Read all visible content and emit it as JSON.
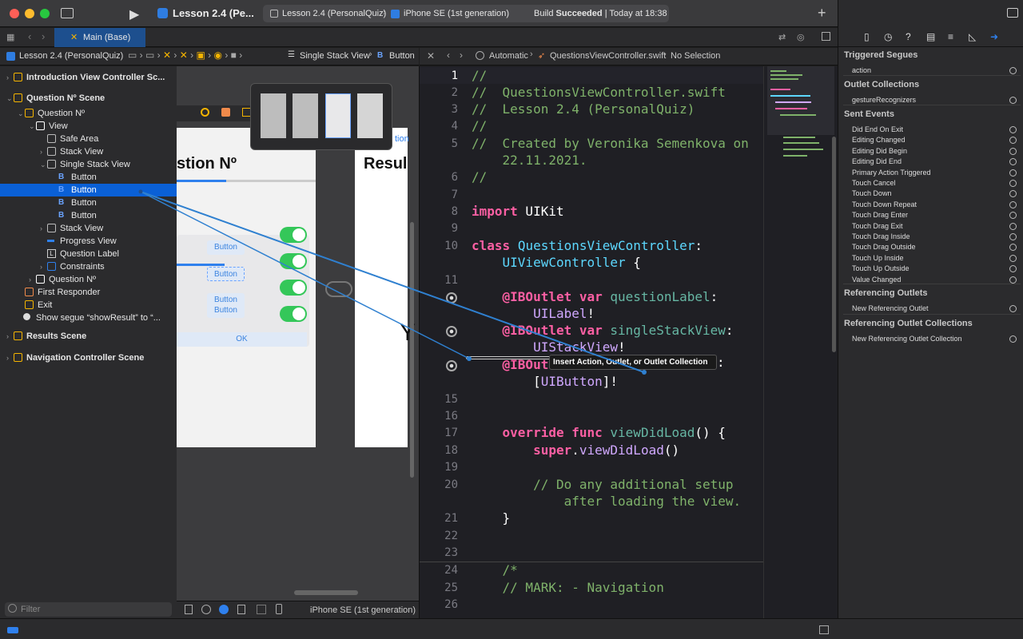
{
  "toolbar": {
    "project_title": "Lesson 2.4 (Pe...",
    "scheme": "Lesson 2.4 (PersonalQuiz)",
    "device": "iPhone SE (1st generation)",
    "build_prefix": "Build ",
    "build_status": "Succeeded",
    "build_time": "| Today at 18:38"
  },
  "tab": {
    "label": "Main (Base)"
  },
  "jumpbar_left": {
    "project": "Lesson 2.4 (PersonalQuiz)",
    "stack": "Single Stack View",
    "button": "Button"
  },
  "jumpbar_right": {
    "mode": "Automatic",
    "file": "QuestionsViewController.swift",
    "selection": "No Selection"
  },
  "navigator": {
    "items": [
      {
        "label": "Introduction View Controller Sc...",
        "bold": true
      },
      {
        "label": "Question Nº Scene",
        "bold": true
      },
      {
        "label": "Question Nº"
      },
      {
        "label": "View"
      },
      {
        "label": "Safe Area"
      },
      {
        "label": "Stack View"
      },
      {
        "label": "Single Stack View"
      },
      {
        "label": "Button"
      },
      {
        "label": "Button"
      },
      {
        "label": "Button"
      },
      {
        "label": "Button"
      },
      {
        "label": "Stack View"
      },
      {
        "label": "Progress View"
      },
      {
        "label": "Question Label"
      },
      {
        "label": "Constraints"
      },
      {
        "label": "Question Nº"
      },
      {
        "label": "First Responder"
      },
      {
        "label": "Exit"
      },
      {
        "label": "Show segue “showResult” to “..."
      },
      {
        "label": "Results Scene",
        "bold": true
      },
      {
        "label": "Navigation Controller Scene",
        "bold": true
      }
    ],
    "filter_placeholder": "Filter"
  },
  "canvas": {
    "question_title": "stion Nº",
    "results_title": "Resul",
    "results_link": "tion",
    "buttons": [
      "Button",
      "Button",
      "Button",
      "Button"
    ],
    "ok": "OK",
    "y_glyph": "Y",
    "device_label": "iPhone SE (1st generation)"
  },
  "code": {
    "lines": [
      {
        "n": "1",
        "parts": [
          [
            "c-com",
            "//"
          ]
        ]
      },
      {
        "n": "2",
        "parts": [
          [
            "c-com",
            "//  QuestionsViewController.swift"
          ]
        ]
      },
      {
        "n": "3",
        "parts": [
          [
            "c-com",
            "//  Lesson 2.4 (PersonalQuiz)"
          ]
        ]
      },
      {
        "n": "4",
        "parts": [
          [
            "c-com",
            "//"
          ]
        ]
      },
      {
        "n": "5",
        "parts": [
          [
            "c-com",
            "//  Created by Veronika Semenkova on"
          ]
        ]
      },
      {
        "n": "",
        "parts": [
          [
            "c-com",
            "    22.11.2021."
          ]
        ]
      },
      {
        "n": "6",
        "parts": [
          [
            "c-com",
            "//"
          ]
        ]
      },
      {
        "n": "7",
        "parts": []
      },
      {
        "n": "8",
        "parts": [
          [
            "c-kw",
            "import"
          ],
          [
            "c-pl",
            " UIKit"
          ]
        ]
      },
      {
        "n": "9",
        "parts": []
      },
      {
        "n": "10",
        "parts": [
          [
            "c-kw",
            "class"
          ],
          [
            "c-pl",
            " "
          ],
          [
            "c-ty",
            "QuestionsViewController"
          ],
          [
            "c-pl",
            ":"
          ]
        ]
      },
      {
        "n": "",
        "parts": [
          [
            "c-pl",
            "    "
          ],
          [
            "c-ty",
            "UIViewController"
          ],
          [
            "c-pl",
            " {"
          ]
        ]
      },
      {
        "n": "11",
        "parts": []
      },
      {
        "n": "",
        "parts": [
          [
            "c-kw",
            "    @IBOutlet var"
          ],
          [
            "c-pl",
            " "
          ],
          [
            "c-fn",
            "questionLabel"
          ],
          [
            "c-pl",
            ":"
          ]
        ]
      },
      {
        "n": "",
        "parts": [
          [
            "c-pl",
            "        "
          ],
          [
            "c-id",
            "UILabel"
          ],
          [
            "c-pl",
            "!"
          ]
        ]
      },
      {
        "n": "",
        "parts": [
          [
            "c-kw",
            "    @IBOutlet var"
          ],
          [
            "c-pl",
            " "
          ],
          [
            "c-fn",
            "singleStackView"
          ],
          [
            "c-pl",
            ":"
          ]
        ]
      },
      {
        "n": "",
        "parts": [
          [
            "c-pl",
            "        "
          ],
          [
            "c-id",
            "UIStackView"
          ],
          [
            "c-pl",
            "!"
          ]
        ]
      },
      {
        "n": "",
        "parts": [
          [
            "c-kw",
            "    @IBOut"
          ]
        ]
      },
      {
        "n": "",
        "parts": [
          [
            "c-pl",
            "        ["
          ],
          [
            "c-id",
            "UIButton"
          ],
          [
            "c-pl",
            "]!"
          ]
        ]
      },
      {
        "n": "15",
        "parts": []
      },
      {
        "n": "16",
        "parts": []
      },
      {
        "n": "17",
        "parts": [
          [
            "c-kw",
            "    override func"
          ],
          [
            "c-pl",
            " "
          ],
          [
            "c-fn",
            "viewDidLoad"
          ],
          [
            "c-pl",
            "() {"
          ]
        ]
      },
      {
        "n": "18",
        "parts": [
          [
            "c-pl",
            "        "
          ],
          [
            "c-kw",
            "super"
          ],
          [
            "c-pl",
            "."
          ],
          [
            "c-id",
            "viewDidLoad"
          ],
          [
            "c-pl",
            "()"
          ]
        ]
      },
      {
        "n": "19",
        "parts": []
      },
      {
        "n": "20",
        "parts": [
          [
            "c-com",
            "        // Do any additional setup"
          ]
        ]
      },
      {
        "n": "",
        "parts": [
          [
            "c-com",
            "            after loading the view."
          ]
        ]
      },
      {
        "n": "21",
        "parts": [
          [
            "c-pl",
            "    }"
          ]
        ]
      },
      {
        "n": "22",
        "parts": []
      },
      {
        "n": "23",
        "parts": []
      },
      {
        "n": "24",
        "parts": [
          [
            "c-com",
            "    /*"
          ]
        ]
      },
      {
        "n": "25",
        "parts": [
          [
            "c-com",
            "    // MARK: - Navigation"
          ]
        ]
      },
      {
        "n": "26",
        "parts": []
      }
    ],
    "tooltip": "Insert Action, Outlet, or Outlet Collection",
    "tooltip_suffix": ":"
  },
  "inspector": {
    "sections": [
      {
        "title": "Triggered Segues",
        "items": [
          "action"
        ]
      },
      {
        "title": "Outlet Collections",
        "items": [
          "gestureRecognizers"
        ]
      },
      {
        "title": "Sent Events",
        "items": [
          "Did End On Exit",
          "Editing Changed",
          "Editing Did Begin",
          "Editing Did End",
          "Primary Action Triggered",
          "Touch Cancel",
          "Touch Down",
          "Touch Down Repeat",
          "Touch Drag Enter",
          "Touch Drag Exit",
          "Touch Drag Inside",
          "Touch Drag Outside",
          "Touch Up Inside",
          "Touch Up Outside",
          "Value Changed"
        ]
      },
      {
        "title": "Referencing Outlets",
        "items": [
          "New Referencing Outlet"
        ]
      },
      {
        "title": "Referencing Outlet Collections",
        "items": [
          "New Referencing Outlet Collection"
        ]
      }
    ]
  },
  "colors": {
    "accent": "#0a60d6",
    "connection": "#2f80d0",
    "toggle": "#34c759"
  }
}
